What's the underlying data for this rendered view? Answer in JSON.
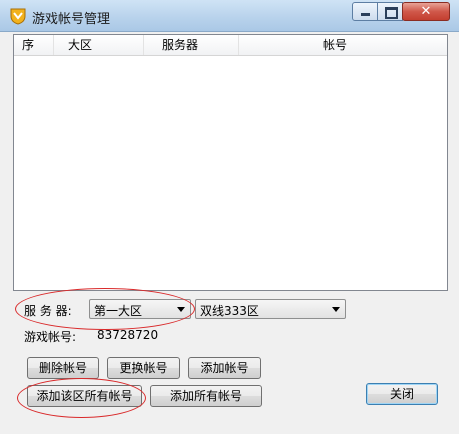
{
  "window": {
    "title": "游戏帐号管理",
    "close_glyph": "✕"
  },
  "list": {
    "columns": [
      "序",
      "大区",
      "服务器",
      "帐号"
    ]
  },
  "server": {
    "label": "服 务 器:",
    "region_value": "第一大区",
    "server_value": "双线333区"
  },
  "account": {
    "label": "游戏帐号:",
    "value": "83728720"
  },
  "buttons": {
    "delete": "删除帐号",
    "replace": "更换帐号",
    "add": "添加帐号",
    "add_region_all": "添加该区所有帐号",
    "add_all": "添加所有帐号",
    "close": "关闭"
  },
  "colors": {
    "annotation": "#d9292a",
    "title_bar": "#b9d3ec"
  }
}
